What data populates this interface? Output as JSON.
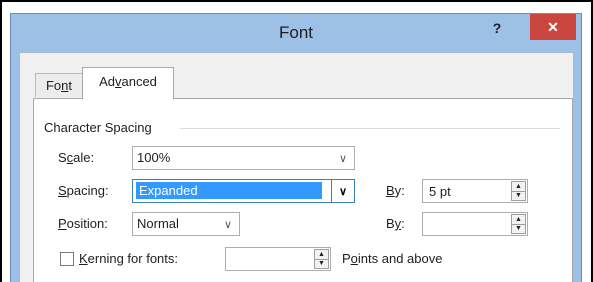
{
  "dialog": {
    "title": "Font",
    "help_label": "?",
    "close_label": "✕",
    "tabs": [
      {
        "label_pre": "Fo",
        "label_acc": "n",
        "label_post": "t",
        "selected": false
      },
      {
        "label_pre": "Ad",
        "label_acc": "v",
        "label_post": "anced",
        "selected": true
      }
    ]
  },
  "character_spacing": {
    "group_title": "Character Spacing",
    "scale": {
      "label_pre": "S",
      "label_acc": "c",
      "label_post": "ale:",
      "value": "100%"
    },
    "spacing": {
      "label_pre": "",
      "label_acc": "S",
      "label_post": "pacing:",
      "value": "Expanded",
      "by_label_pre": "",
      "by_label_acc": "B",
      "by_label_post": "y:",
      "by_value": "5 pt"
    },
    "position": {
      "label_pre": "",
      "label_acc": "P",
      "label_post": "osition:",
      "value": "Normal",
      "by_label_pre": "B",
      "by_label_acc": "y",
      "by_label_post": ":",
      "by_value": ""
    },
    "kerning": {
      "label_pre": "",
      "label_acc": "K",
      "label_post": "erning for fonts:",
      "checked": false,
      "value": "",
      "suffix_pre": "P",
      "suffix_acc": "o",
      "suffix_post": "ints and above"
    }
  },
  "icons": {
    "dropdown": "chevron-down-icon",
    "spin_up": "spin-up-icon",
    "spin_down": "spin-down-icon"
  },
  "colors": {
    "titlebar": "#9cc0e6",
    "close": "#c9473e",
    "selection": "#3399ff",
    "focus_border": "#3c7fb1"
  }
}
